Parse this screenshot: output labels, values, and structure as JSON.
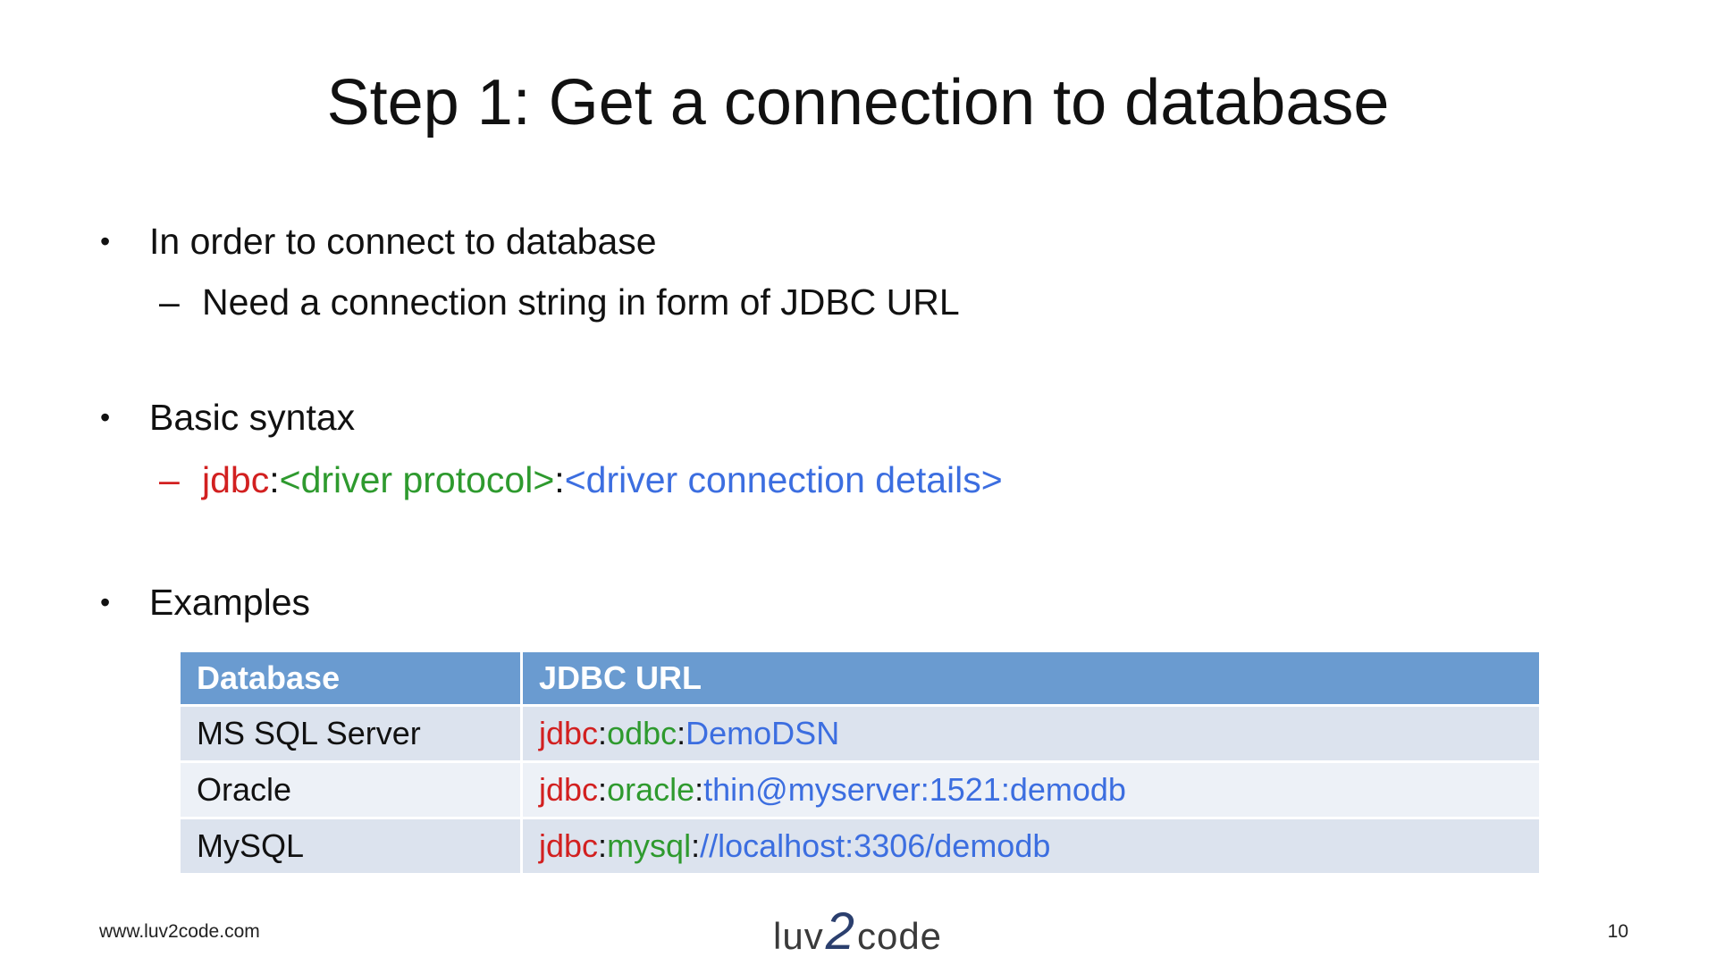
{
  "title": "Step 1: Get a connection to database",
  "bullets": [
    {
      "text": "In order to connect to database",
      "sub": "Need a connection string in form of JDBC URL"
    },
    {
      "text": "Basic syntax",
      "syntax": {
        "prefix": "jdbc",
        "sep1": ":",
        "protocol": "<driver protocol>",
        "sep2": ":",
        "details": "<driver connection details>"
      }
    },
    {
      "text": "Examples"
    }
  ],
  "table": {
    "headers": [
      "Database",
      "JDBC URL"
    ],
    "rows": [
      {
        "database": "MS SQL Server",
        "prefix": "jdbc",
        "sep1": ":",
        "protocol": "odbc",
        "sep2": ":",
        "details": "DemoDSN"
      },
      {
        "database": "Oracle",
        "prefix": "jdbc",
        "sep1": ":",
        "protocol": "oracle",
        "sep2": ":",
        "details": "thin@myserver:1521:demodb"
      },
      {
        "database": "MySQL",
        "prefix": "jdbc",
        "sep1": ":",
        "protocol": "mysql",
        "sep2": ":",
        "details": "//localhost:3306/demodb"
      }
    ]
  },
  "footer": {
    "site": "www.luv2code.com",
    "logo": {
      "left": "luv",
      "mid": "2",
      "right": "code"
    },
    "page": "10"
  },
  "colors": {
    "jdbc": "#d22020",
    "protocol": "#2e9a2e",
    "details": "#3c6ee0",
    "table_header": "#6a9bd0"
  }
}
